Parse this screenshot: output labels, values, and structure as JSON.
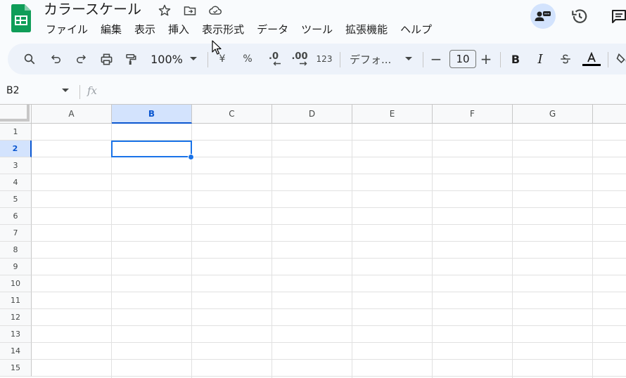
{
  "document": {
    "title": "カラースケール"
  },
  "menu": [
    "ファイル",
    "編集",
    "表示",
    "挿入",
    "表示形式",
    "データ",
    "ツール",
    "拡張機能",
    "ヘルプ"
  ],
  "toolbar": {
    "zoom": "100%",
    "currency": "¥",
    "percent": "%",
    "decrease_decimal": ".0",
    "increase_decimal": ".00",
    "number_format": "123",
    "font": "デフォ...",
    "font_size": "10",
    "minus": "−",
    "plus": "+",
    "bold": "B",
    "italic": "I",
    "text_color_accent": "#000000"
  },
  "formula_bar": {
    "name_box": "B2",
    "fx": "fx"
  },
  "grid": {
    "columns": [
      "A",
      "B",
      "C",
      "D",
      "E",
      "F",
      "G"
    ],
    "rows": [
      "1",
      "2",
      "3",
      "4",
      "5",
      "6",
      "7",
      "8",
      "9",
      "10",
      "11",
      "12",
      "13",
      "14",
      "15"
    ],
    "selected_cell": "B2",
    "selected_column": "B",
    "selected_row": "2"
  },
  "colors": {
    "accent": "#1a73e8",
    "selection": "#d3e3fd",
    "sheets_green": "#0f9d58"
  }
}
